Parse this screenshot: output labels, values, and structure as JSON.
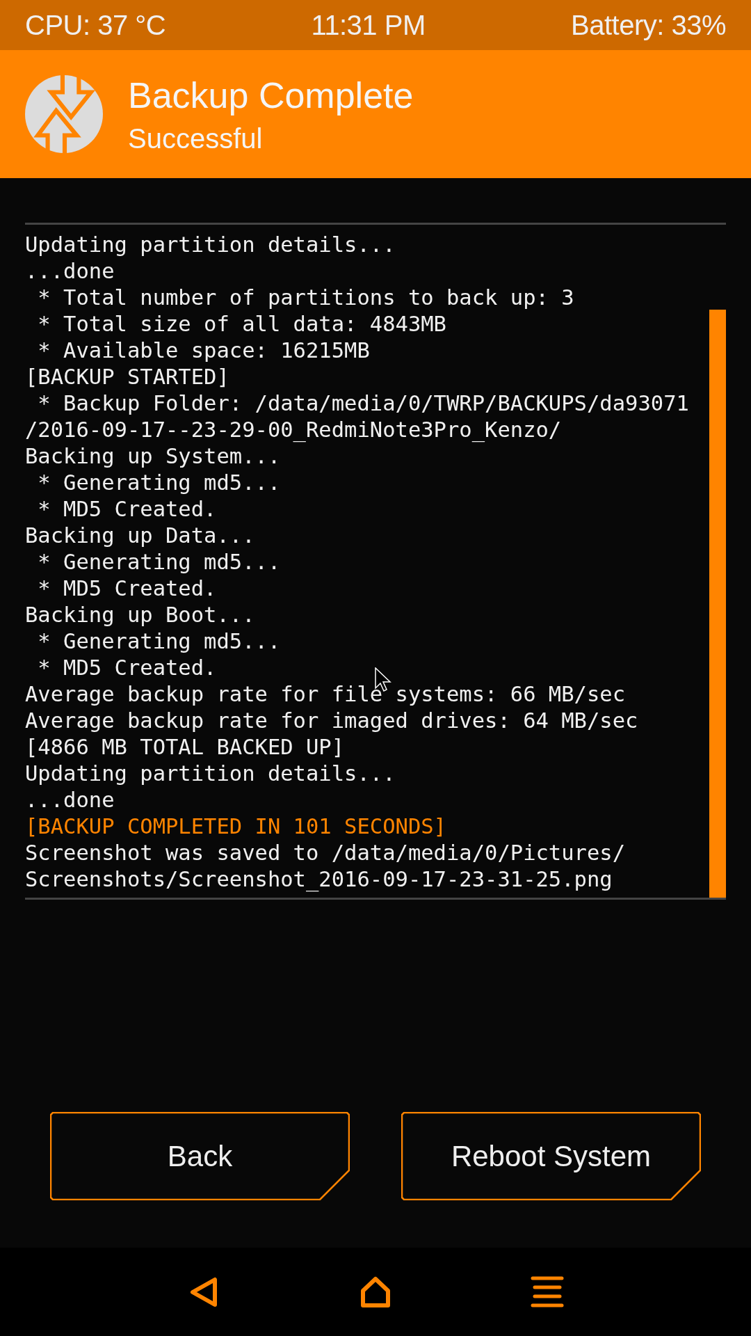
{
  "status_bar": {
    "cpu": "CPU: 37 °C",
    "time": "11:31 PM",
    "battery": "Battery: 33%"
  },
  "header": {
    "title": "Backup Complete",
    "subtitle": "Successful"
  },
  "log": [
    {
      "text": "Updating partition details...",
      "kind": "normal"
    },
    {
      "text": "...done",
      "kind": "normal"
    },
    {
      "text": " * Total number of partitions to back up: 3",
      "kind": "normal"
    },
    {
      "text": " * Total size of all data: 4843MB",
      "kind": "normal"
    },
    {
      "text": " * Available space: 16215MB",
      "kind": "normal"
    },
    {
      "text": "[BACKUP STARTED]",
      "kind": "normal"
    },
    {
      "text": " * Backup Folder: /data/media/0/TWRP/BACKUPS/da93071",
      "kind": "normal"
    },
    {
      "text": "/2016-09-17--23-29-00_RedmiNote3Pro_Kenzo/",
      "kind": "normal"
    },
    {
      "text": "Backing up System...",
      "kind": "normal"
    },
    {
      "text": " * Generating md5...",
      "kind": "normal"
    },
    {
      "text": " * MD5 Created.",
      "kind": "normal"
    },
    {
      "text": "Backing up Data...",
      "kind": "normal"
    },
    {
      "text": " * Generating md5...",
      "kind": "normal"
    },
    {
      "text": " * MD5 Created.",
      "kind": "normal"
    },
    {
      "text": "Backing up Boot...",
      "kind": "normal"
    },
    {
      "text": " * Generating md5...",
      "kind": "normal"
    },
    {
      "text": " * MD5 Created.",
      "kind": "normal"
    },
    {
      "text": "Average backup rate for file systems: 66 MB/sec",
      "kind": "normal"
    },
    {
      "text": "Average backup rate for imaged drives: 64 MB/sec",
      "kind": "normal"
    },
    {
      "text": "[4866 MB TOTAL BACKED UP]",
      "kind": "normal"
    },
    {
      "text": "Updating partition details...",
      "kind": "normal"
    },
    {
      "text": "...done",
      "kind": "normal"
    },
    {
      "text": "[BACKUP COMPLETED IN 101 SECONDS]",
      "kind": "highlight"
    },
    {
      "text": "Screenshot was saved to /data/media/0/Pictures/",
      "kind": "normal"
    },
    {
      "text": "Screenshots/Screenshot_2016-09-17-23-31-25.png",
      "kind": "normal"
    }
  ],
  "buttons": [
    "Back",
    "Reboot System"
  ]
}
